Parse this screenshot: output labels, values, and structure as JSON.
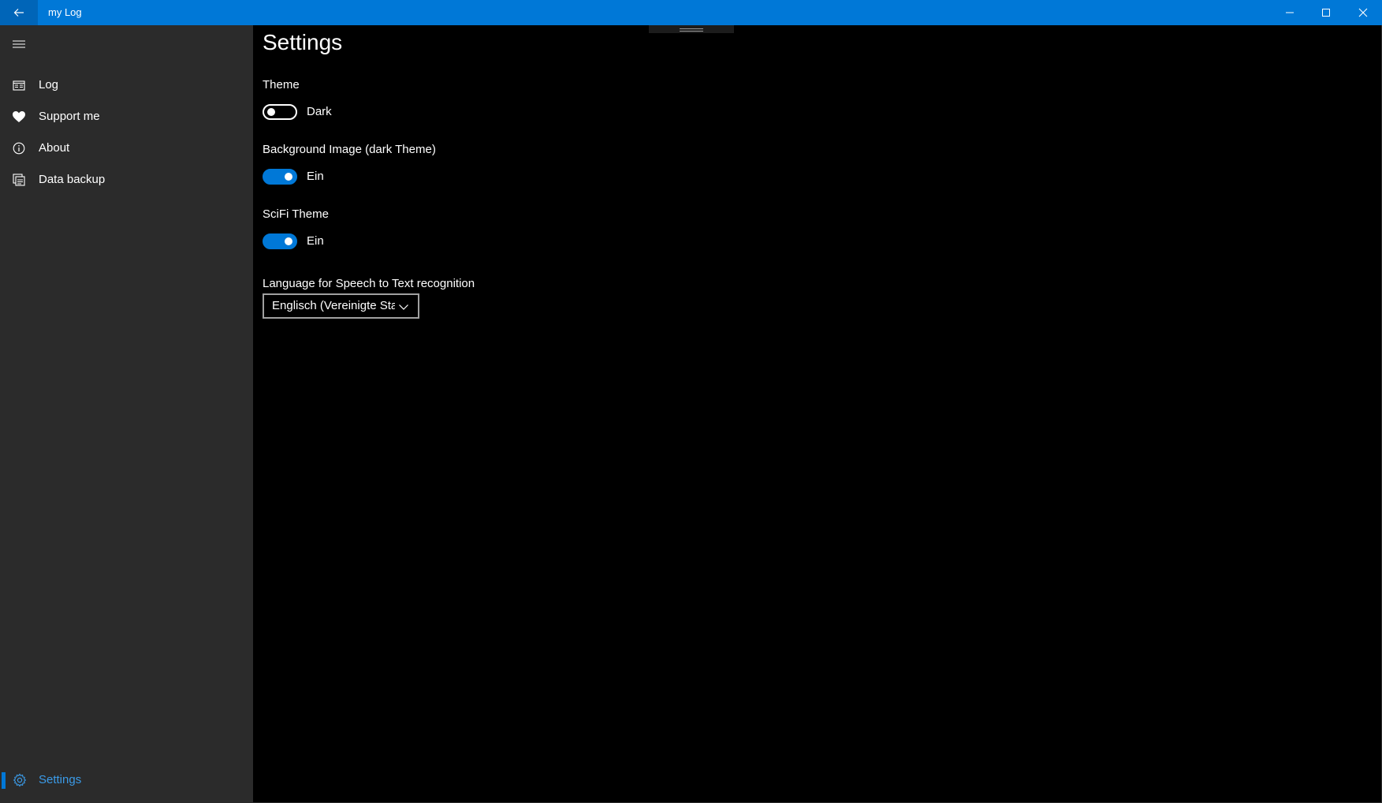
{
  "window": {
    "title": "my Log"
  },
  "sidebar": {
    "items": [
      {
        "label": "Log",
        "icon": "log-icon"
      },
      {
        "label": "Support me",
        "icon": "heart-icon"
      },
      {
        "label": "About",
        "icon": "info-icon"
      },
      {
        "label": "Data backup",
        "icon": "backup-icon"
      }
    ],
    "settings": {
      "label": "Settings",
      "icon": "gear-icon",
      "selected": true
    }
  },
  "main": {
    "title": "Settings",
    "theme": {
      "label": "Theme",
      "toggle_on": false,
      "state_text": "Dark"
    },
    "background_image": {
      "label": "Background Image (dark Theme)",
      "toggle_on": true,
      "state_text": "Ein"
    },
    "scifi_theme": {
      "label": "SciFi Theme",
      "toggle_on": true,
      "state_text": "Ein"
    },
    "language": {
      "label": "Language for Speech to Text recognition",
      "selected_value": "Englisch (Vereinigte Staaten)"
    }
  },
  "colors": {
    "accent": "#0078d7",
    "sidebar_bg": "#2b2b2b",
    "content_bg": "#000000"
  }
}
